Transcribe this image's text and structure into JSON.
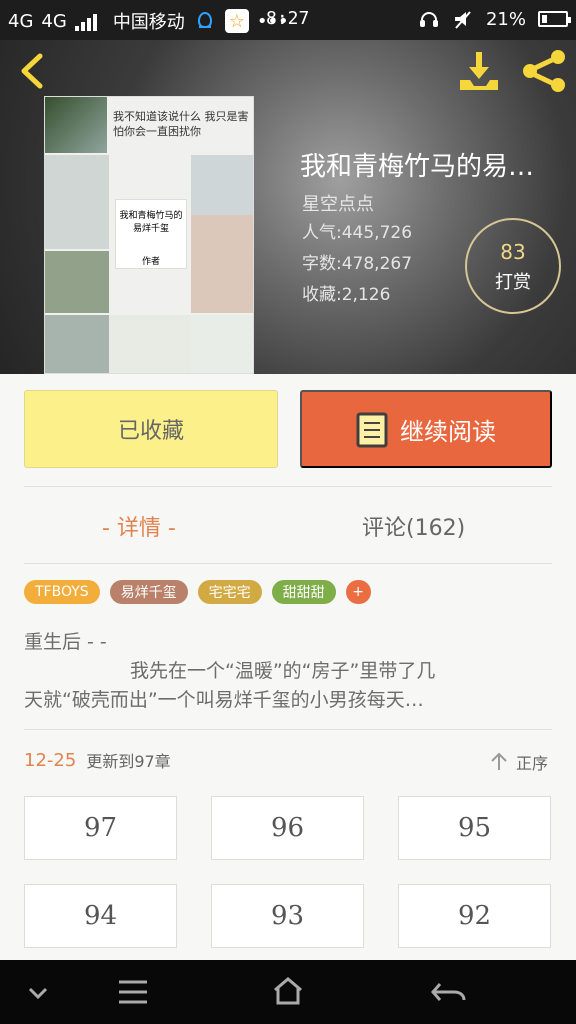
{
  "status_bar": {
    "network_left": "4G",
    "network_right": "4G",
    "carrier": "中国移动",
    "time": "8:27",
    "battery": "21%",
    "battery_level": 0.21,
    "more": "•••",
    "icons": [
      "signal-icon",
      "qq-icon",
      "star-app-icon",
      "headphones-icon",
      "mute-icon",
      "battery-icon"
    ]
  },
  "header": {
    "book_title": "我和青梅竹马的易…",
    "author": "星空点点",
    "popularity": "人气:445,726",
    "word_count": "字数:478,267",
    "favorites": "收藏:2,126",
    "tip_count": "83",
    "tip_label": "打赏"
  },
  "cover": {
    "top_text": "我不知道该说什么 我只是害怕你会一直困扰你",
    "title": "我和青梅竹马的易烊千玺",
    "author": "作者"
  },
  "actions": {
    "collected": "已收藏",
    "continue_reading": "继续阅读"
  },
  "tabs": {
    "details": "- 详情 -",
    "comments": "评论(162)"
  },
  "tags": [
    {
      "label": "TFBOYS",
      "color": "#f2ad3a"
    },
    {
      "label": "易烊千玺",
      "color": "#b98169"
    },
    {
      "label": "宅宅宅",
      "color": "#d1aa43"
    },
    {
      "label": "甜甜甜",
      "color": "#7fae49"
    },
    {
      "label": "+",
      "color": "#eb6e43"
    }
  ],
  "synopsis": {
    "line1": "重生后 - -",
    "line2": "我先在一个“温暖”的“房子”里带了几",
    "line3": "天就“破壳而出”一个叫易烊千玺的小男孩每天…"
  },
  "update": {
    "date": "12-25",
    "text": "更新到97章",
    "sort_label": "正序"
  },
  "chapters": [
    "97",
    "96",
    "95",
    "94",
    "93",
    "92"
  ],
  "navigation": {
    "items": [
      "chevron-down-icon",
      "menu-icon",
      "home-icon",
      "back-icon"
    ]
  }
}
